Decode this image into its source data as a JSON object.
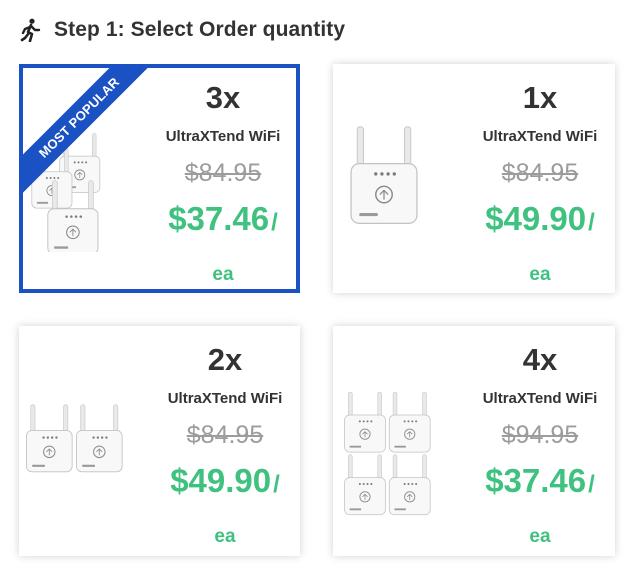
{
  "header": {
    "icon": "walking-person-icon",
    "title": "Step 1: Select Order quantity"
  },
  "colors": {
    "accent": "#1a52c4",
    "price_green": "#3fc17f",
    "old_price_gray": "#9c9c9c",
    "text": "#333333"
  },
  "options": [
    {
      "quantity": "3x",
      "product": "UltraXTend WiFi",
      "old_price": "$84.95",
      "price": "$37.46",
      "slash": "/",
      "unit": "ea",
      "badge": "MOST POPULAR",
      "selected": true,
      "image": "three-wifi-extenders-image"
    },
    {
      "quantity": "1x",
      "product": "UltraXTend WiFi",
      "old_price": "$84.95",
      "price": "$49.90",
      "slash": "/",
      "unit": "ea",
      "selected": false,
      "image": "one-wifi-extender-image"
    },
    {
      "quantity": "2x",
      "product": "UltraXTend WiFi",
      "old_price": "$84.95",
      "price": "$49.90",
      "slash": "/",
      "unit": "ea",
      "selected": false,
      "image": "two-wifi-extenders-image"
    },
    {
      "quantity": "4x",
      "product": "UltraXTend WiFi",
      "old_price": "$94.95",
      "price": "$37.46",
      "slash": "/",
      "unit": "ea",
      "selected": false,
      "image": "four-wifi-extenders-image"
    }
  ]
}
